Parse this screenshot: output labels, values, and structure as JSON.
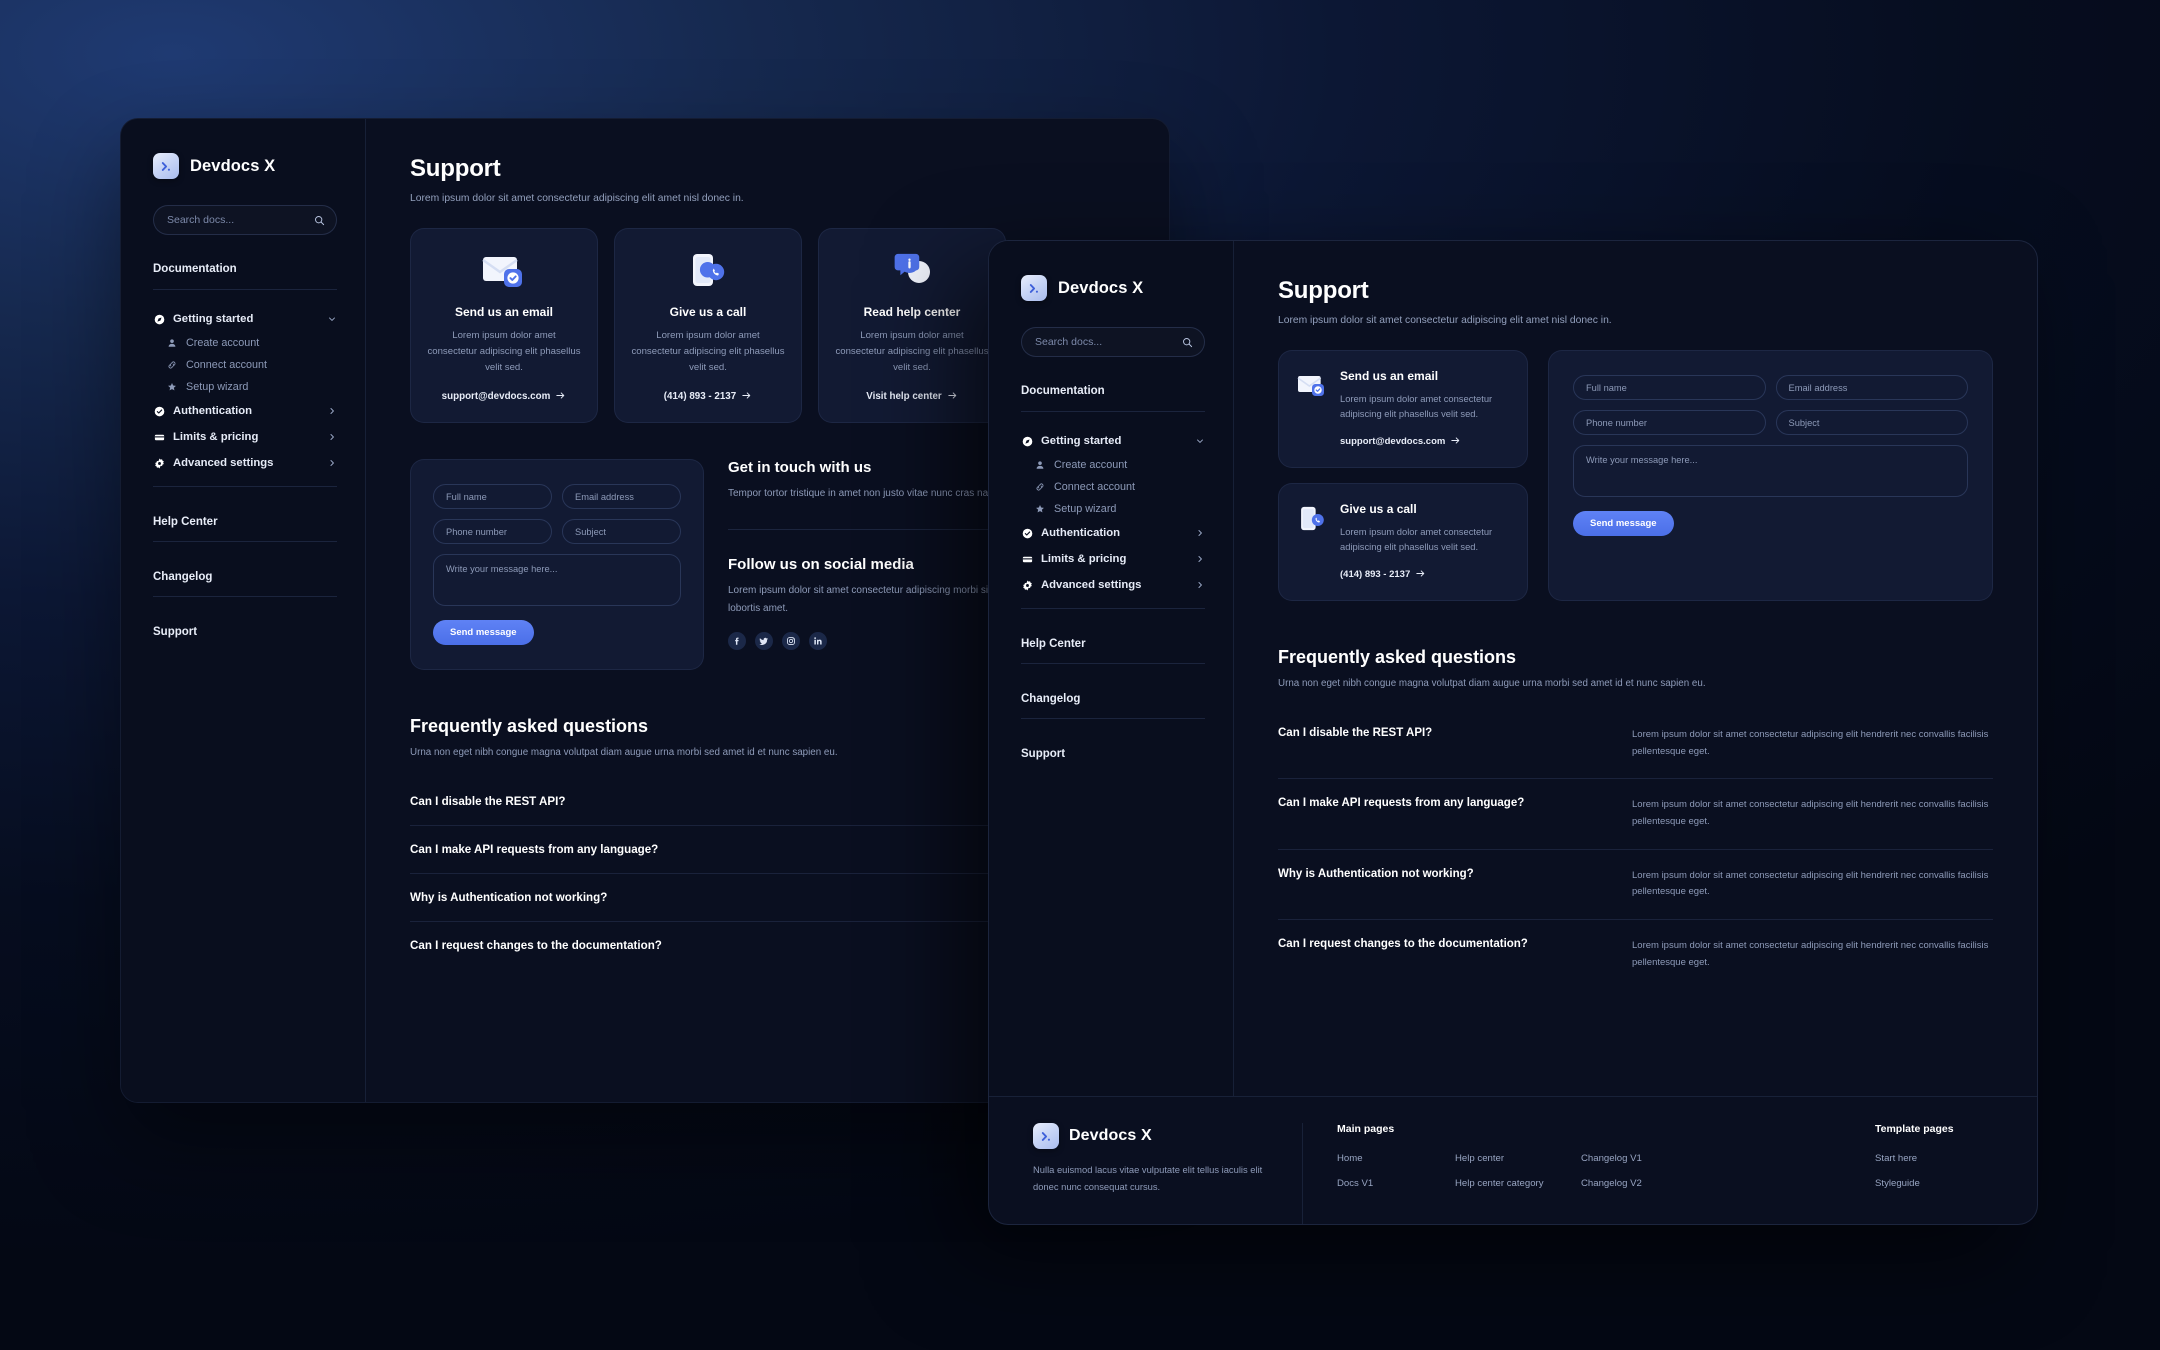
{
  "brand": {
    "name": "Devdocs X",
    "icon": "chevron-right-logo-icon"
  },
  "search": {
    "placeholder": "Search docs...",
    "value": "",
    "icon": "search-icon"
  },
  "sidebar": {
    "section_title": "Documentation",
    "groups": [
      {
        "label": "Getting started",
        "icon": "compass-icon",
        "chevron": "chevron-down-icon",
        "expanded": true,
        "children": [
          {
            "label": "Create account",
            "icon": "user-icon"
          },
          {
            "label": "Connect account",
            "icon": "link-icon"
          },
          {
            "label": "Setup wizard",
            "icon": "star-icon"
          }
        ]
      },
      {
        "label": "Authentication",
        "icon": "check-badge-icon",
        "chevron": "chevron-right-icon",
        "expanded": false,
        "children": []
      },
      {
        "label": "Limits & pricing",
        "icon": "card-icon",
        "chevron": "chevron-right-icon",
        "expanded": false,
        "children": []
      },
      {
        "label": "Advanced settings",
        "icon": "gear-icon",
        "chevron": "chevron-right-icon",
        "expanded": false,
        "children": []
      }
    ],
    "links": [
      {
        "label": "Help Center"
      },
      {
        "label": "Changelog"
      },
      {
        "label": "Support"
      }
    ]
  },
  "page": {
    "title": "Support",
    "subtitle": "Lorem ipsum dolor sit amet consectetur adipiscing elit amet nisl donec in."
  },
  "support_cards": [
    {
      "icon": "envelope-check-icon",
      "title": "Send us an email",
      "body": "Lorem ipsum dolor amet consectetur adipiscing elit phasellus velit sed.",
      "link": "support@devdocs.com",
      "arrow": "arrow-right-icon"
    },
    {
      "icon": "phone-call-icon",
      "title": "Give us a call",
      "body": "Lorem ipsum dolor amet consectetur adipiscing elit phasellus velit sed.",
      "link": "(414) 893 - 2137",
      "arrow": "arrow-right-icon"
    },
    {
      "icon": "info-bubble-icon",
      "title": "Read help center",
      "body": "Lorem ipsum dolor amet consectetur adipiscing elit phasellus velit sed.",
      "link": "Visit help center",
      "arrow": "arrow-right-icon"
    }
  ],
  "form": {
    "fields": [
      {
        "name": "full-name",
        "placeholder": "Full name",
        "value": ""
      },
      {
        "name": "email",
        "placeholder": "Email address",
        "value": ""
      },
      {
        "name": "phone",
        "placeholder": "Phone number",
        "value": ""
      },
      {
        "name": "subject",
        "placeholder": "Subject",
        "value": ""
      }
    ],
    "message_placeholder": "Write your message here...",
    "message_value": "",
    "submit_label": "Send message"
  },
  "touch": {
    "title": "Get in touch with us",
    "body": "Tempor tortor tristique in amet non justo vitae nunc cras nascetur id.",
    "social_title": "Follow us on social media",
    "social_body": "Lorem ipsum dolor sit amet consectetur adipiscing morbi sit sit rutrum aliquet cursus lobortis amet.",
    "socials": [
      "facebook-icon",
      "twitter-icon",
      "instagram-icon",
      "linkedin-icon"
    ]
  },
  "faq": {
    "title": "Frequently asked questions",
    "subtitle": "Urna non eget nibh congue magna volutpat diam augue urna morbi sed amet id et nunc sapien eu.",
    "answer_text": "Lorem ipsum dolor sit amet consectetur adipiscing elit hendrerit nec convallis facilisis pellentesque eget.",
    "items": [
      {
        "q": "Can I disable the REST API?"
      },
      {
        "q": "Can I make API requests from any language?"
      },
      {
        "q": "Why is Authentication not working?"
      },
      {
        "q": "Can I request changes to the documentation?"
      }
    ]
  },
  "footer": {
    "brand": "Devdocs X",
    "description": "Nulla euismod lacus vitae vulputate elit tellus iaculis elit donec nunc consequat cursus.",
    "columns": [
      {
        "head": "Main pages",
        "links": [
          "Home",
          "Docs V1"
        ]
      },
      {
        "head": "",
        "links": [
          "Help center",
          "Help center category"
        ]
      },
      {
        "head": "",
        "links": [
          "Changelog V1",
          "Changelog V2"
        ]
      },
      {
        "head": "Template pages",
        "links": [
          "Start here",
          "Styleguide"
        ]
      }
    ]
  },
  "colors": {
    "accent": "#5072ea",
    "panel_bg": "#0a0f20",
    "card_bg": "#121a33",
    "text": "#ffffff",
    "muted": "#8e9bb9"
  }
}
